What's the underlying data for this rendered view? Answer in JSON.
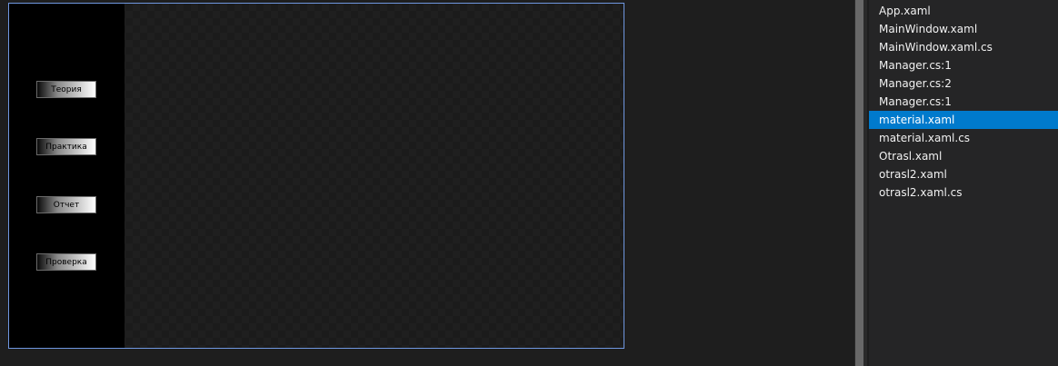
{
  "designer": {
    "nav_buttons": [
      {
        "label": "Теория"
      },
      {
        "label": "Практика"
      },
      {
        "label": "Отчет"
      },
      {
        "label": "Проверка"
      }
    ]
  },
  "files": {
    "items": [
      {
        "name": "App.xaml"
      },
      {
        "name": "MainWindow.xaml"
      },
      {
        "name": "MainWindow.xaml.cs"
      },
      {
        "name": "Manager.cs:1"
      },
      {
        "name": "Manager.cs:2"
      },
      {
        "name": "Manager.cs:1"
      },
      {
        "name": "material.xaml"
      },
      {
        "name": "material.xaml.cs"
      },
      {
        "name": "Otrasl.xaml"
      },
      {
        "name": "otrasl2.xaml"
      },
      {
        "name": "otrasl2.xaml.cs"
      }
    ],
    "selected_index": 6
  },
  "colors": {
    "selection": "#007acc",
    "frame_border": "#6f97e0",
    "side_panel": "#000000"
  }
}
